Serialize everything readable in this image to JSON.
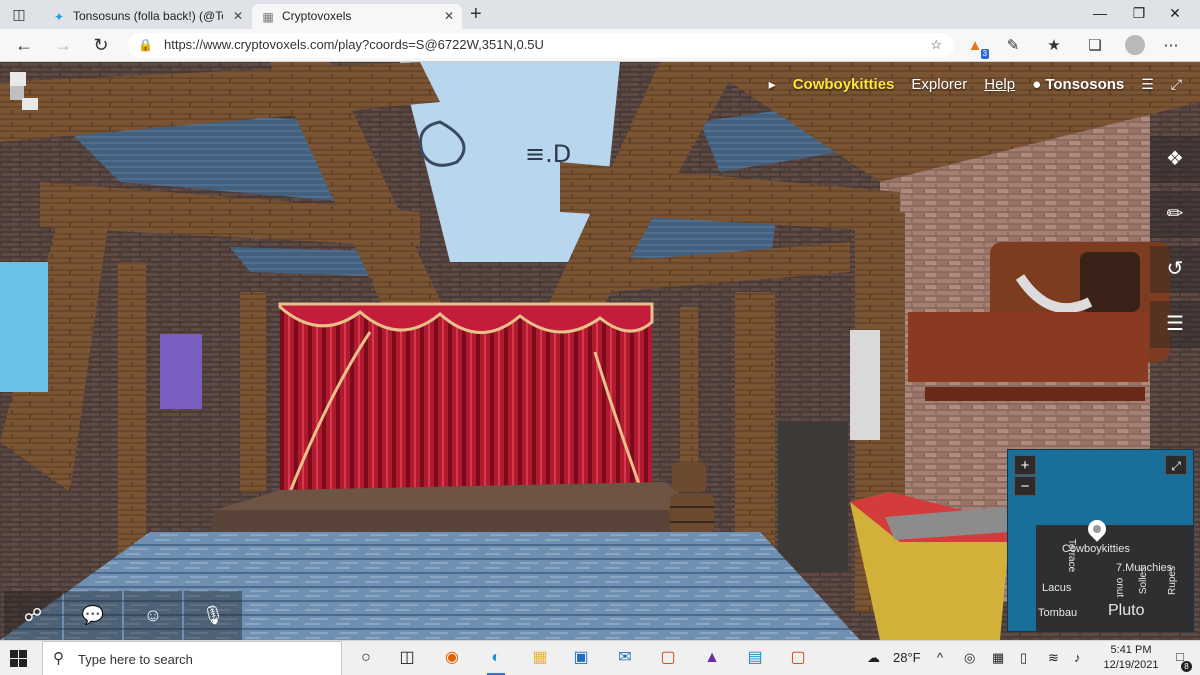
{
  "browser": {
    "tabs": [
      {
        "label": "Tonsosuns (folla back!) (@Tonso",
        "favicon": "twitter-bird-icon",
        "active": false
      },
      {
        "label": "Cryptovoxels",
        "favicon": "cryptovoxels-icon",
        "active": true
      }
    ],
    "new_tab": "+",
    "url": "https://www.cryptovoxels.com/play?coords=S@6722W,351N,0.5U",
    "extension_badge": "3"
  },
  "hud": {
    "world_name": "Cowboykitties",
    "explorer": "Explorer",
    "help": "Help",
    "username": "Tonsosons"
  },
  "sign_text": "≡.D",
  "minimap": {
    "zoom_in": "+",
    "zoom_out": "−",
    "labels": [
      "Cowboykitties",
      "7.Munchies",
      "Lacus",
      "Terrace",
      "Tombau",
      "Pluto",
      "Solles",
      "Rupes",
      "onut"
    ]
  },
  "taskbar": {
    "search_placeholder": "Type here to search",
    "weather": "28°F",
    "time": "5:41 PM",
    "date": "12/19/2021",
    "notification_count": "8"
  },
  "colors": {
    "hud_highlight": "#ffe53a",
    "minimap_water": "#1a6f9a",
    "curtain": "#b11a2e"
  }
}
